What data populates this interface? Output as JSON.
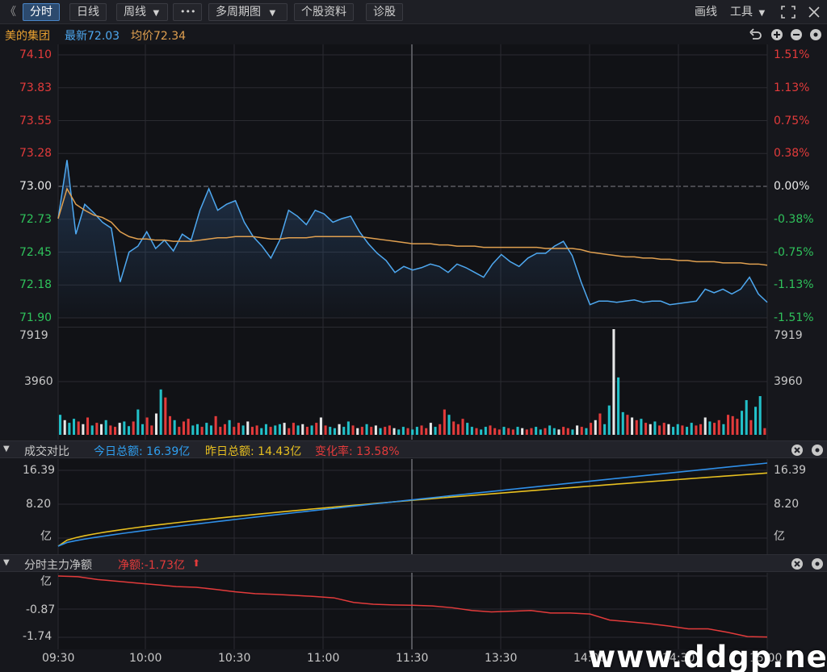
{
  "toolbar": {
    "back": "《",
    "tabs": [
      "分时",
      "日线"
    ],
    "period_select": "周线",
    "more": "•••",
    "multi_period": "多周期图",
    "profile": "个股资料",
    "diagnose": "诊股",
    "draw": "画线",
    "tools": "工具"
  },
  "info": {
    "name": "美的集团",
    "latest": "最新72.03",
    "avg": "均价72.34"
  },
  "price_axis": {
    "left": [
      "74.10",
      "73.83",
      "73.55",
      "73.28",
      "73.00",
      "72.73",
      "72.45",
      "72.18",
      "71.90"
    ],
    "right": [
      "1.51%",
      "1.13%",
      "0.75%",
      "0.38%",
      "0.00%",
      "-0.38%",
      "-0.75%",
      "-1.13%",
      "-1.51%"
    ]
  },
  "volume_axis": {
    "top": "7919",
    "mid": "3960"
  },
  "compare": {
    "title": "成交对比",
    "today": "今日总额: 16.39亿",
    "yesterday": "昨日总额: 14.43亿",
    "change": "变化率: 13.58%",
    "axis": [
      "16.39",
      "8.20",
      "亿"
    ]
  },
  "netflow": {
    "title": "分时主力净额",
    "net": "净额:-1.73亿",
    "arrow": "⬆",
    "axis": [
      "亿",
      "-0.87",
      "-1.74"
    ]
  },
  "time_axis": [
    "09:30",
    "10:00",
    "10:30",
    "11:00",
    "11:30",
    "13:30",
    "14:00",
    "14:30",
    "15:00"
  ],
  "watermark": "www.ddgp.net",
  "colors": {
    "price_line": "#4ea8f0",
    "avg_line": "#e0a050",
    "up": "#e33b3b",
    "down": "#22c0c8",
    "today_amount": "#2f8fe8",
    "yesterday_amount": "#e8c020",
    "netflow_line": "#e33b3b"
  },
  "chart_data": [
    {
      "type": "line",
      "title": "",
      "ylim": [
        71.9,
        74.1
      ],
      "x": [
        "09:30",
        "09:33",
        "09:36",
        "09:39",
        "09:42",
        "09:45",
        "09:48",
        "09:51",
        "09:54",
        "09:57",
        "10:00",
        "10:03",
        "10:06",
        "10:09",
        "10:12",
        "10:15",
        "10:18",
        "10:21",
        "10:24",
        "10:27",
        "10:30",
        "10:33",
        "10:36",
        "10:39",
        "10:42",
        "10:45",
        "10:48",
        "10:51",
        "10:54",
        "10:57",
        "11:00",
        "11:03",
        "11:06",
        "11:09",
        "11:12",
        "11:15",
        "11:18",
        "11:21",
        "11:24",
        "11:27",
        "11:30",
        "13:03",
        "13:06",
        "13:09",
        "13:12",
        "13:15",
        "13:18",
        "13:21",
        "13:24",
        "13:27",
        "13:30",
        "13:33",
        "13:36",
        "13:39",
        "13:42",
        "13:45",
        "13:48",
        "13:51",
        "13:54",
        "13:57",
        "14:00",
        "14:03",
        "14:06",
        "14:09",
        "14:12",
        "14:15",
        "14:18",
        "14:21",
        "14:24",
        "14:27",
        "14:30",
        "14:33",
        "14:36",
        "14:39",
        "14:42",
        "14:45",
        "14:48",
        "14:51",
        "14:54",
        "14:57",
        "15:00"
      ],
      "series": [
        {
          "name": "最新",
          "values": [
            72.73,
            73.22,
            72.6,
            72.85,
            72.78,
            72.7,
            72.65,
            72.2,
            72.45,
            72.5,
            72.62,
            72.48,
            72.55,
            72.46,
            72.6,
            72.55,
            72.8,
            72.98,
            72.8,
            72.85,
            72.88,
            72.7,
            72.58,
            72.5,
            72.4,
            72.55,
            72.8,
            72.75,
            72.68,
            72.8,
            72.77,
            72.7,
            72.73,
            72.75,
            72.62,
            72.52,
            72.44,
            72.38,
            72.28,
            72.33,
            72.3,
            72.32,
            72.35,
            72.33,
            72.28,
            72.35,
            72.32,
            72.28,
            72.24,
            72.35,
            72.43,
            72.37,
            72.33,
            72.4,
            72.44,
            72.44,
            72.5,
            72.54,
            72.42,
            72.2,
            72.01,
            72.04,
            72.04,
            72.03,
            72.04,
            72.05,
            72.03,
            72.04,
            72.04,
            72.01,
            72.02,
            72.03,
            72.04,
            72.14,
            72.11,
            72.14,
            72.1,
            72.14,
            72.24,
            72.1,
            72.03
          ]
        },
        {
          "name": "均价",
          "values": [
            72.73,
            72.98,
            72.85,
            72.8,
            72.76,
            72.74,
            72.7,
            72.62,
            72.58,
            72.56,
            72.56,
            72.55,
            72.55,
            72.54,
            72.54,
            72.54,
            72.55,
            72.56,
            72.57,
            72.57,
            72.58,
            72.58,
            72.58,
            72.57,
            72.56,
            72.56,
            72.57,
            72.57,
            72.57,
            72.58,
            72.58,
            72.58,
            72.58,
            72.58,
            72.58,
            72.57,
            72.56,
            72.55,
            72.54,
            72.53,
            72.52,
            72.52,
            72.52,
            72.51,
            72.51,
            72.5,
            72.5,
            72.5,
            72.49,
            72.49,
            72.49,
            72.49,
            72.49,
            72.49,
            72.49,
            72.48,
            72.48,
            72.48,
            72.48,
            72.47,
            72.45,
            72.44,
            72.43,
            72.42,
            72.41,
            72.41,
            72.4,
            72.4,
            72.39,
            72.39,
            72.38,
            72.38,
            72.37,
            72.37,
            72.37,
            72.36,
            72.36,
            72.36,
            72.35,
            72.35,
            72.34
          ]
        }
      ]
    },
    {
      "type": "bar",
      "title": "",
      "ylim": [
        0,
        7919
      ],
      "values": [
        1500,
        1100,
        900,
        1200,
        1000,
        800,
        1300,
        700,
        900,
        800,
        1100,
        700,
        600,
        900,
        1000,
        650,
        1000,
        1900,
        800,
        1300,
        700,
        1600,
        3400,
        2800,
        1400,
        1100,
        600,
        1000,
        1200,
        700,
        800,
        600,
        900,
        700,
        1400,
        600,
        800,
        1100,
        600,
        900,
        700,
        1000,
        600,
        700,
        500,
        800,
        600,
        700,
        800,
        900,
        500,
        900,
        700,
        800,
        600,
        700,
        900,
        1300,
        700,
        600,
        500,
        800,
        600,
        1000,
        700,
        500,
        600,
        800,
        600,
        700,
        500,
        600,
        700,
        500,
        400,
        600,
        500,
        400,
        600,
        700,
        500,
        900,
        600,
        800,
        1900,
        1500,
        1000,
        800,
        1200,
        900,
        600,
        500,
        400,
        600,
        700,
        500,
        400,
        600,
        500,
        400,
        600,
        500,
        400,
        500,
        600,
        400,
        500,
        700,
        500,
        400,
        600,
        500,
        400,
        700,
        600,
        500,
        900,
        1100,
        1600,
        800,
        2200,
        7919,
        4300,
        1700,
        1500,
        1300,
        1100,
        1200,
        900,
        800,
        1000,
        700,
        900,
        800,
        600,
        800,
        700,
        600,
        900,
        700,
        800,
        1300,
        1000,
        900,
        1100,
        800,
        1500,
        1400,
        1200,
        1800,
        2600,
        1100,
        2100,
        2900,
        500
      ]
    }
  ]
}
